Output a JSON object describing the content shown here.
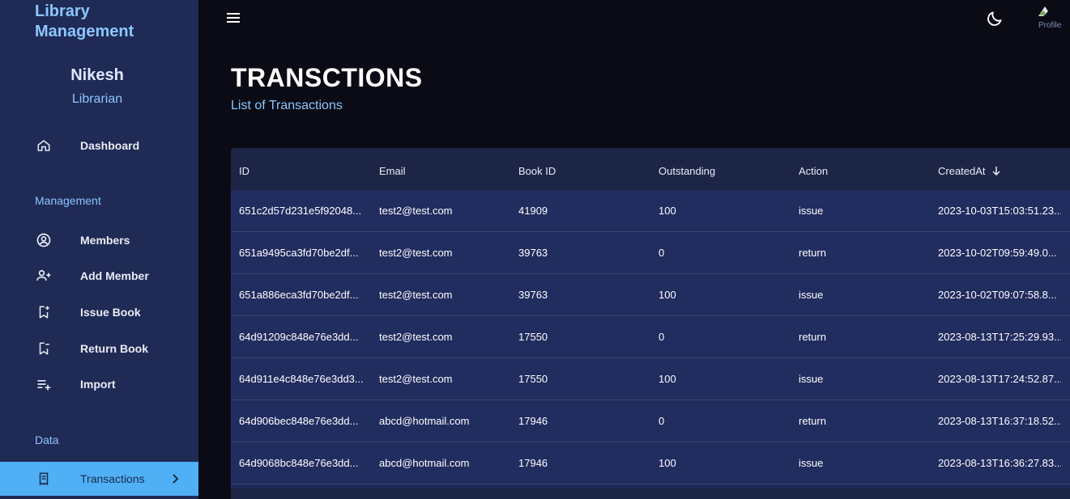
{
  "sidebar": {
    "brand": "Library Management",
    "profile": {
      "name": "Nikesh",
      "role": "Librarian"
    },
    "dashboard_label": "Dashboard",
    "management_section": "Management",
    "management_items": [
      {
        "label": "Members",
        "icon": "user-circle-icon"
      },
      {
        "label": "Add Member",
        "icon": "person-add-icon"
      },
      {
        "label": "Issue Book",
        "icon": "bookmark-add-icon"
      },
      {
        "label": "Return Book",
        "icon": "bookmark-remove-icon"
      },
      {
        "label": "Import",
        "icon": "playlist-add-icon"
      }
    ],
    "data_section": "Data",
    "transactions_label": "Transactions"
  },
  "topbar": {
    "avatar_alt": "Profile"
  },
  "header": {
    "title": "TRANSCTIONS",
    "subtitle": "List of Transactions"
  },
  "table": {
    "columns": [
      "ID",
      "Email",
      "Book ID",
      "Outstanding",
      "Action",
      "CreatedAt"
    ],
    "sort_column": "CreatedAt",
    "rows": [
      [
        "651c2d57d231e5f92048...",
        "test2@test.com",
        "41909",
        "100",
        "issue",
        "2023-10-03T15:03:51.23..."
      ],
      [
        "651a9495ca3fd70be2df...",
        "test2@test.com",
        "39763",
        "0",
        "return",
        "2023-10-02T09:59:49.0..."
      ],
      [
        "651a886eca3fd70be2df...",
        "test2@test.com",
        "39763",
        "100",
        "issue",
        "2023-10-02T09:07:58.8..."
      ],
      [
        "64d91209c848e76e3dd...",
        "test2@test.com",
        "17550",
        "0",
        "return",
        "2023-08-13T17:25:29.93..."
      ],
      [
        "64d911e4c848e76e3dd3...",
        "test2@test.com",
        "17550",
        "100",
        "issue",
        "2023-08-13T17:24:52.87..."
      ],
      [
        "64d906bec848e76e3dd...",
        "abcd@hotmail.com",
        "17946",
        "0",
        "return",
        "2023-08-13T16:37:18.52..."
      ],
      [
        "64d9068bc848e76e3dd...",
        "abcd@hotmail.com",
        "17946",
        "100",
        "issue",
        "2023-08-13T16:36:27.83..."
      ]
    ]
  },
  "colors": {
    "sidebar_bg": "#1f2a55",
    "accent": "#8cc6ff",
    "active_item": "#50b0f5",
    "main_bg": "#0a0b14",
    "table_bg": "#212c5f"
  }
}
